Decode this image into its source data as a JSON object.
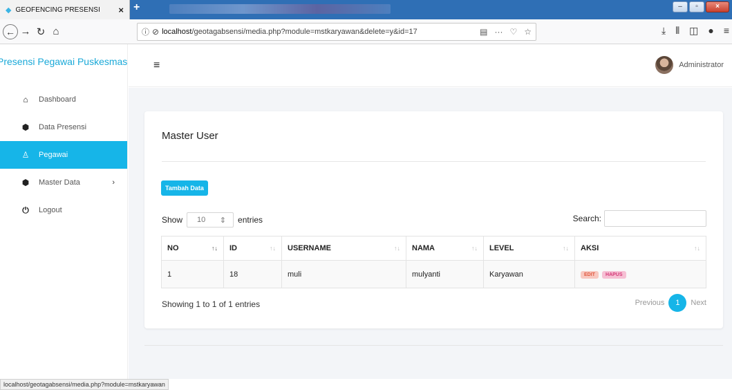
{
  "browser": {
    "tab_title": "GEOFENCING PRESENSI",
    "tab_close": "×",
    "new_tab": "+",
    "url_host": "localhost",
    "url_path": "/geotagabsensi/media.php?module=mstkaryawan&delete=y&id=17",
    "status_url": "localhost/geotagabsensi/media.php?module=mstkaryawan",
    "accent": "#2f6fb5"
  },
  "sidebar": {
    "brand": "Presensi Pegawai Puskesmas",
    "items": [
      {
        "label": "Dashboard",
        "icon": "home-icon"
      },
      {
        "label": "Data Presensi",
        "icon": "cube-icon"
      },
      {
        "label": "Pegawai",
        "icon": "user-icon",
        "active": true
      },
      {
        "label": "Master Data",
        "icon": "cube-icon",
        "chevron": "›"
      },
      {
        "label": "Logout",
        "icon": "power-icon"
      }
    ],
    "active_color": "#16b5e8"
  },
  "header": {
    "user_name": "Administrator"
  },
  "card": {
    "title": "Master User",
    "add_button": "Tambah Data",
    "show_label": "Show",
    "entries_label": "entries",
    "page_length": "10",
    "search_label": "Search:",
    "search_value": ""
  },
  "table": {
    "columns": [
      "NO",
      "ID",
      "USERNAME",
      "NAMA",
      "LEVEL",
      "AKSI"
    ],
    "rows": [
      {
        "no": "1",
        "id": "18",
        "username": "muli",
        "nama": "mulyanti",
        "level": "Karyawan",
        "edit": "EDIT",
        "hapus": "HAPUS"
      }
    ]
  },
  "footer": {
    "info": "Showing 1 to 1 of 1 entries",
    "previous": "Previous",
    "page": "1",
    "next": "Next"
  }
}
